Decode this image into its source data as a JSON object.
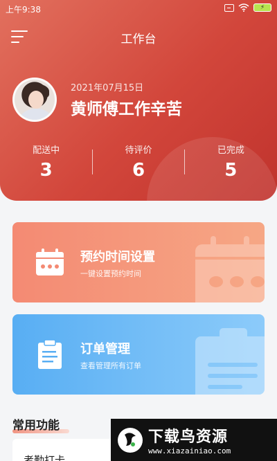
{
  "status_bar": {
    "time": "上午9:38",
    "battery": "⚡"
  },
  "header": {
    "title": "工作台",
    "date": "2021年07月15日",
    "greeting": "黄师傅工作辛苦",
    "stats": [
      {
        "label": "配送中",
        "value": "3"
      },
      {
        "label": "待评价",
        "value": "6"
      },
      {
        "label": "已完成",
        "value": "5"
      }
    ]
  },
  "cards": [
    {
      "title": "预约时间设置",
      "subtitle": "一键设置预约时间",
      "icon": "calendar-icon"
    },
    {
      "title": "订单管理",
      "subtitle": "查看管理所有订单",
      "icon": "clipboard-icon"
    }
  ],
  "section": {
    "title": "常用功能",
    "first_item": "考勤打卡"
  },
  "watermark": {
    "title": "下载鸟资源",
    "url": "www.xiazainiao.com"
  },
  "colors": {
    "header": "#d2463b",
    "appoint_card": "#f48a73",
    "order_card": "#58aef3"
  }
}
